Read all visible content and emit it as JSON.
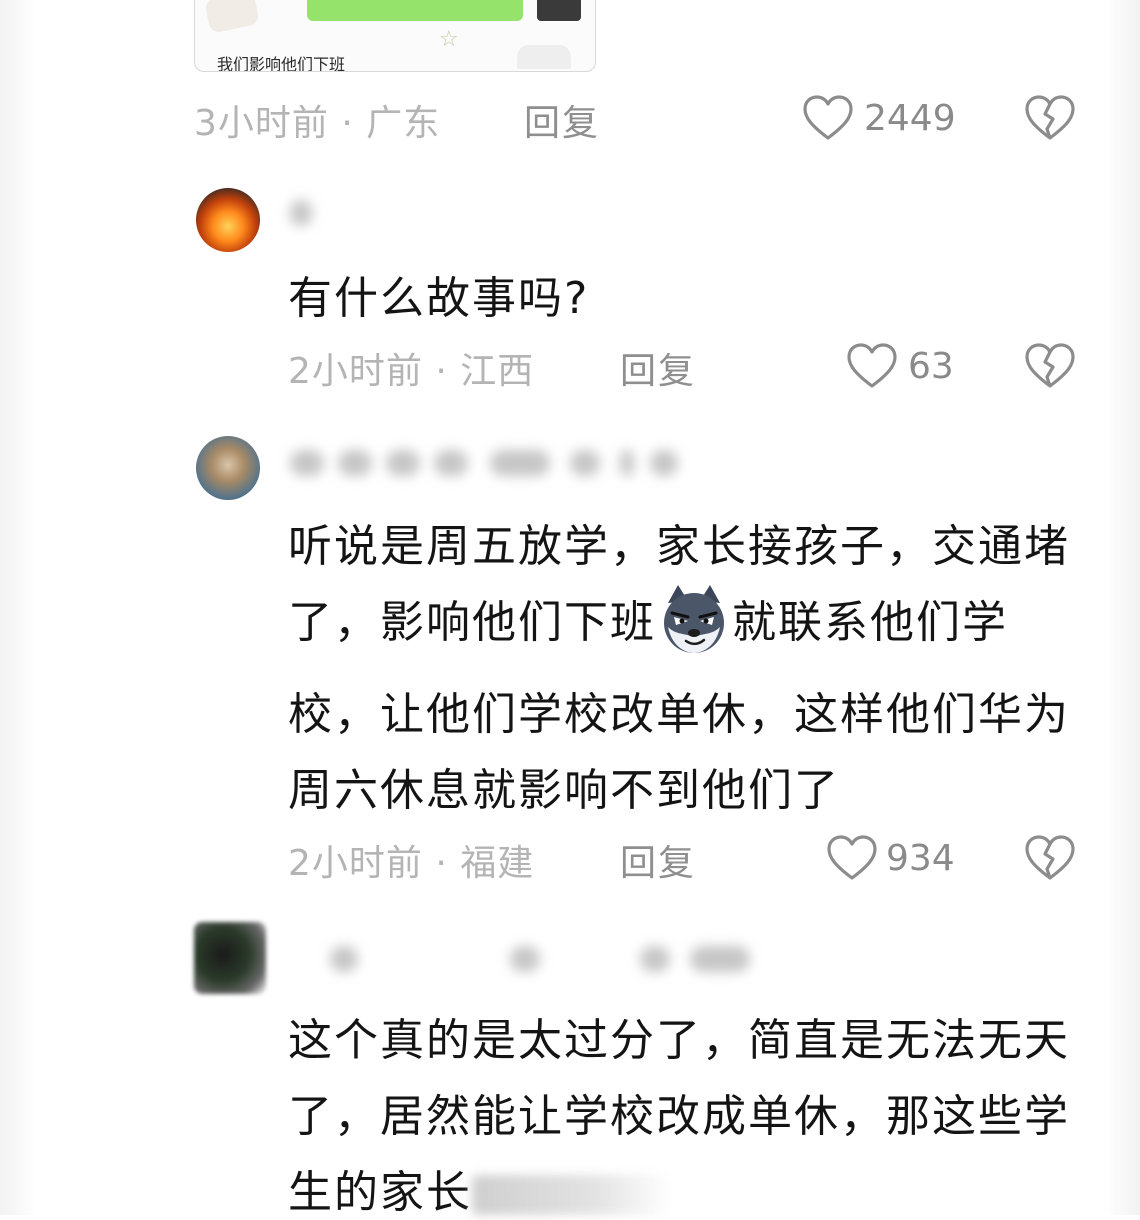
{
  "top_card": {
    "image_caption": "我们影响他们下班"
  },
  "comments": [
    {
      "time_location": "3小时前 · 广东",
      "reply_label": "回复",
      "likes": "2449"
    },
    {
      "text_lines": [
        "有什么故事吗?"
      ],
      "time_location": "2小时前 · 江西",
      "reply_label": "回复",
      "likes": "63"
    },
    {
      "text_lines": [
        "听说是周五放学，家长接孩子，交通堵",
        "了，影响他们下班",
        "就联系他们学",
        "校，让他们学校改单休，这样他们华为",
        "周六休息就影响不到他们了"
      ],
      "time_location": "2小时前 · 福建",
      "reply_label": "回复",
      "likes": "934"
    },
    {
      "text_lines": [
        "这个真的是太过分了，简直是无法无天",
        "了，居然能让学校改成单休，那这些学",
        "生的家长"
      ]
    }
  ],
  "icons": {
    "like": "heart-outline-icon",
    "dislike": "broken-heart-icon",
    "emoji": "husky-dog-emoji"
  },
  "colors": {
    "meta_text": "#b4b4b4",
    "reply_text": "#8f8f8f",
    "icon_stroke": "#8c8c8c"
  }
}
